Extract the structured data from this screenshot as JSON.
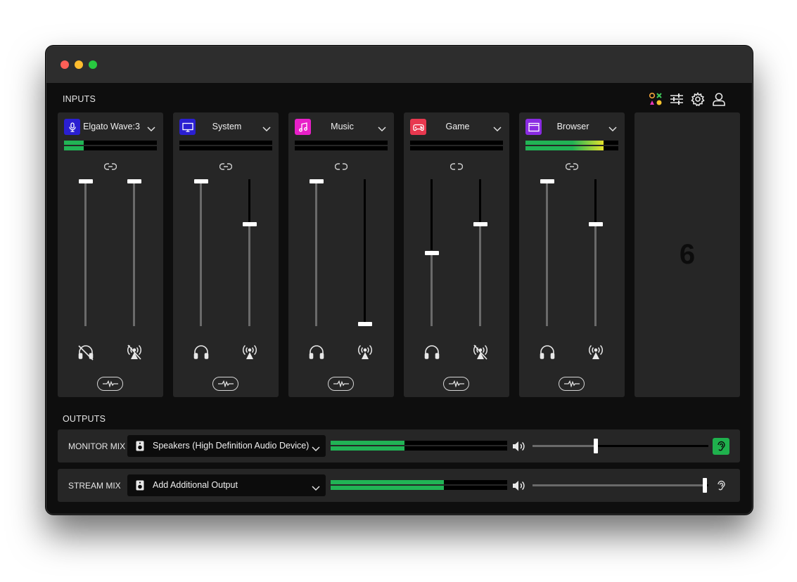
{
  "window": {
    "controls": [
      "close",
      "minimize",
      "zoom"
    ]
  },
  "inputs": {
    "label": "INPUTS",
    "toolbar_icons": [
      "apps-icon",
      "mixer-settings-icon",
      "gear-icon",
      "user-icon"
    ],
    "empty_slot_number": "6",
    "channels": [
      {
        "name": "Elgato Wave:3",
        "icon": "microphone-icon",
        "color": "#2a1fd1",
        "meter_level": 0.21,
        "linked": true,
        "monitor_level": 1.0,
        "stream_level": 1.0,
        "monitor_muted": true,
        "stream_muted": true
      },
      {
        "name": "System",
        "icon": "monitor-icon",
        "color": "#2a1fd1",
        "meter_level": 0.0,
        "linked": true,
        "monitor_level": 1.0,
        "stream_level": 0.7,
        "monitor_muted": false,
        "stream_muted": false
      },
      {
        "name": "Music",
        "icon": "music-note-icon",
        "color": "#e820c8",
        "meter_level": 0.0,
        "linked": false,
        "monitor_level": 1.0,
        "stream_level": 0.0,
        "monitor_muted": false,
        "stream_muted": false
      },
      {
        "name": "Game",
        "icon": "gamepad-icon",
        "color": "#e8384f",
        "meter_level": 0.0,
        "linked": false,
        "monitor_level": 0.5,
        "stream_level": 0.7,
        "monitor_muted": false,
        "stream_muted": true
      },
      {
        "name": "Browser",
        "icon": "browser-window-icon",
        "color": "#8a2be2",
        "meter_level": 0.84,
        "linked": true,
        "monitor_level": 1.0,
        "stream_level": 0.7,
        "monitor_muted": false,
        "stream_muted": false
      }
    ]
  },
  "outputs": {
    "label": "OUTPUTS",
    "rows": [
      {
        "label": "MONITOR MIX",
        "device": "Speakers (High Definition Audio Device)",
        "meter_level": 0.42,
        "volume": 0.36,
        "listen_active": true
      },
      {
        "label": "STREAM MIX",
        "device": "Add Additional Output",
        "meter_level": 0.64,
        "volume": 0.98,
        "listen_active": false
      }
    ]
  },
  "colors": {
    "meter_green": "#21b355",
    "listen_green": "#1fb14d",
    "browser_meter_peak": "#e3e12c"
  }
}
